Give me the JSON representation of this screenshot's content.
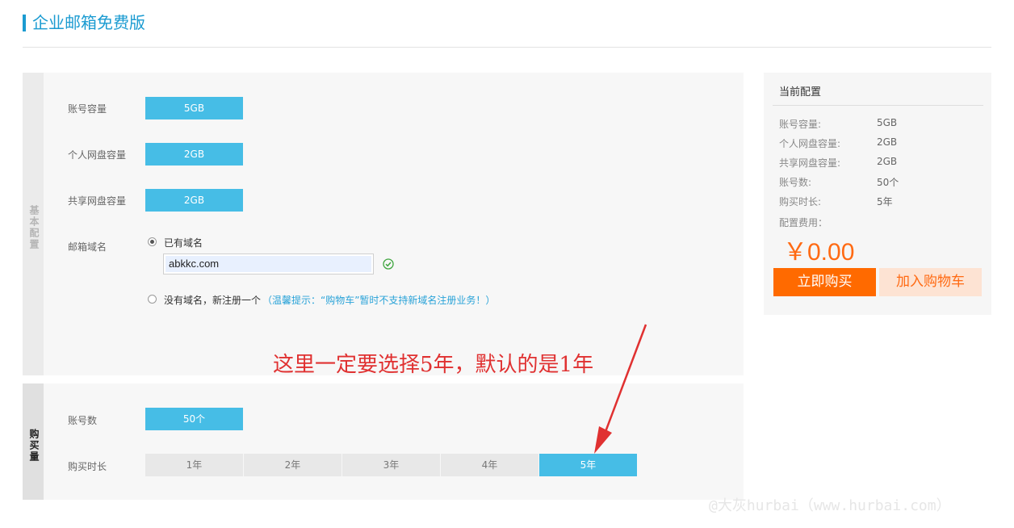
{
  "header": {
    "title": "企业邮箱免费版"
  },
  "basic_config": {
    "tab_label": "基本配置",
    "fields": [
      {
        "label": "账号容量",
        "value": "5GB"
      },
      {
        "label": "个人网盘容量",
        "value": "2GB"
      },
      {
        "label": "共享网盘容量",
        "value": "2GB"
      }
    ],
    "domain": {
      "label": "邮箱域名",
      "option_existing": "已有域名",
      "input_value": "abkkc.com",
      "option_new": "没有域名，新注册一个",
      "tip": "（温馨提示：“购物车”暂时不支持新域名注册业务！）",
      "selected": "existing"
    }
  },
  "purchase": {
    "tab_label": "购买量",
    "accounts": {
      "label": "账号数",
      "value": "50个"
    },
    "duration": {
      "label": "购买时长",
      "options": [
        "1年",
        "2年",
        "3年",
        "4年",
        "5年"
      ],
      "selected": "5年"
    }
  },
  "summary": {
    "title": "当前配置",
    "rows": [
      {
        "key": "账号容量:",
        "value": "5GB"
      },
      {
        "key": "个人网盘容量:",
        "value": "2GB"
      },
      {
        "key": "共享网盘容量:",
        "value": "2GB"
      },
      {
        "key": "账号数:",
        "value": "50个"
      },
      {
        "key": "购买时长:",
        "value": "5年"
      }
    ],
    "fee_label": "配置费用：",
    "price": "￥0.00",
    "buy_label": "立即购买",
    "cart_label": "加入购物车"
  },
  "annotation": {
    "text": "这里一定要选择5年，默认的是1年"
  },
  "watermark": {
    "text": "@大灰hurbai（www.hurbai.com）"
  },
  "colors": {
    "accent": "#46bde6",
    "title": "#1b9bd1",
    "buy": "#ff6a00",
    "cart_bg": "#fde3d3",
    "price": "#ff6a13",
    "annotation": "#e03131"
  },
  "icons": {
    "valid": "check-circle-icon",
    "arrow": "annotation-arrow"
  }
}
